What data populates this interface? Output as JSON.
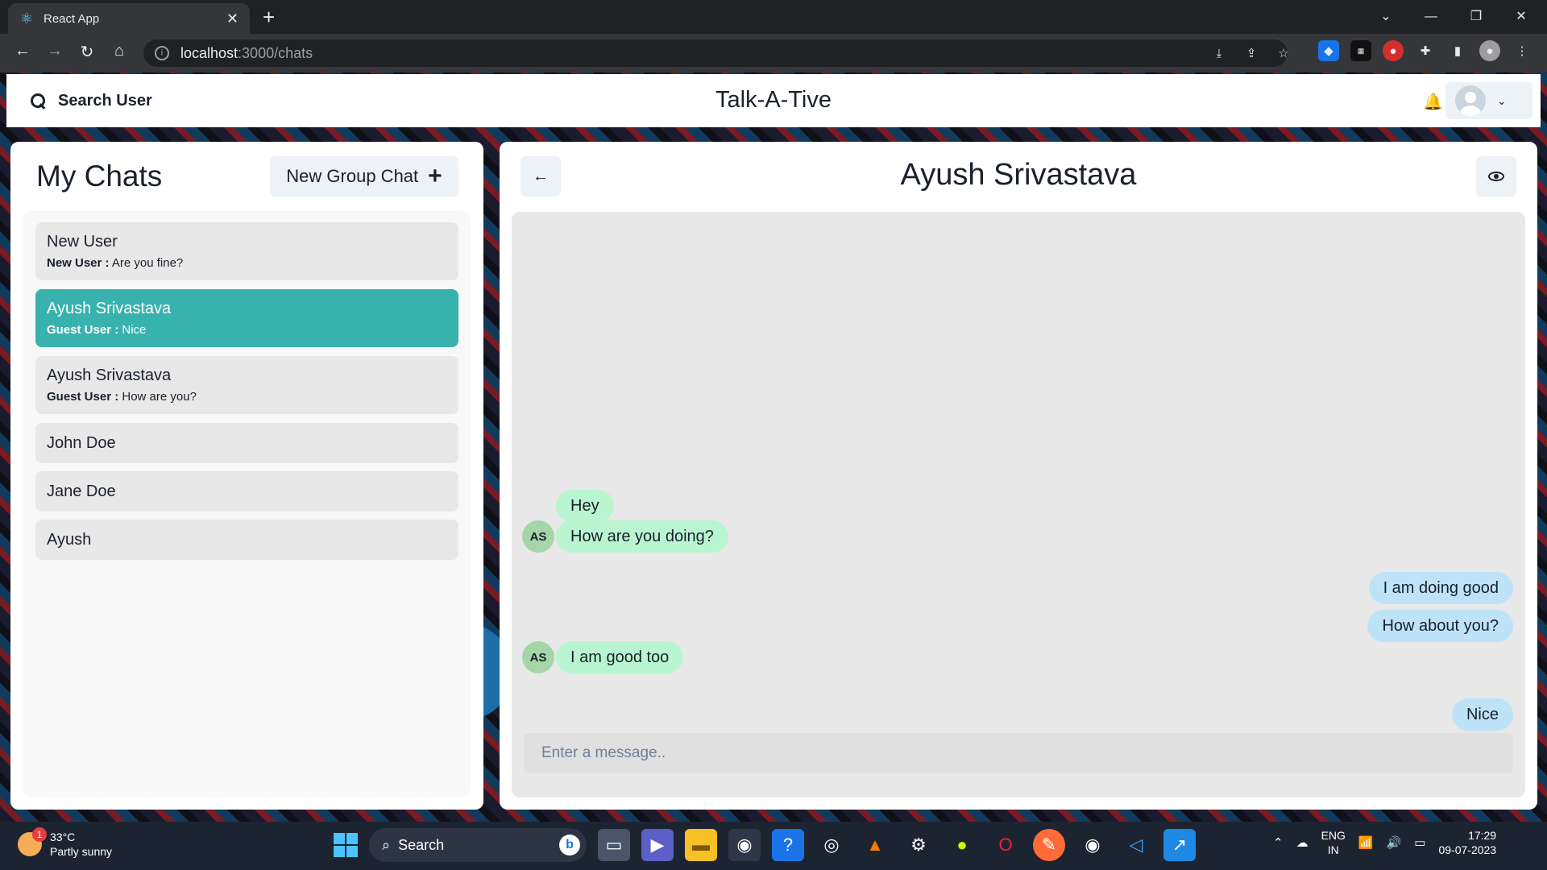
{
  "browser": {
    "tab_title": "React App",
    "url_host": "localhost",
    "url_path": ":3000/chats"
  },
  "app": {
    "search_label": "Search User",
    "brand": "Talk-A-Tive"
  },
  "chats_panel": {
    "title": "My Chats",
    "new_group_label": "New Group Chat",
    "items": [
      {
        "name": "New User",
        "sender": "New User :",
        "latest": "Are you fine?",
        "active": false
      },
      {
        "name": "Ayush Srivastava",
        "sender": "Guest User :",
        "latest": "Nice",
        "active": true
      },
      {
        "name": "Ayush Srivastava",
        "sender": "Guest User :",
        "latest": "How are you?",
        "active": false
      },
      {
        "name": "John Doe",
        "sender": "",
        "latest": "",
        "active": false
      },
      {
        "name": "Jane Doe",
        "sender": "",
        "latest": "",
        "active": false
      },
      {
        "name": "Ayush",
        "sender": "",
        "latest": "",
        "active": false
      }
    ]
  },
  "chat_box": {
    "title": "Ayush Srivastava",
    "messages": [
      {
        "text": "Hey",
        "dir": "in"
      },
      {
        "text": "How are you doing?",
        "dir": "in",
        "avatar": "AS"
      },
      {
        "text": "I am doing good",
        "dir": "out"
      },
      {
        "text": "How about you?",
        "dir": "out"
      },
      {
        "text": "I am good too",
        "dir": "in",
        "avatar": "AS"
      },
      {
        "text": "Nice",
        "dir": "out"
      }
    ],
    "input_placeholder": "Enter a message.."
  },
  "taskbar": {
    "weather_temp": "33°C",
    "weather_desc": "Partly sunny",
    "weather_badge": "1",
    "search_label": "Search",
    "lang_top": "ENG",
    "lang_bottom": "IN",
    "time": "17:29",
    "date": "09-07-2023"
  },
  "colors": {
    "active_chat": "#38b2ac",
    "incoming_bubble": "#b9f5d0",
    "outgoing_bubble": "#bee3f8"
  }
}
